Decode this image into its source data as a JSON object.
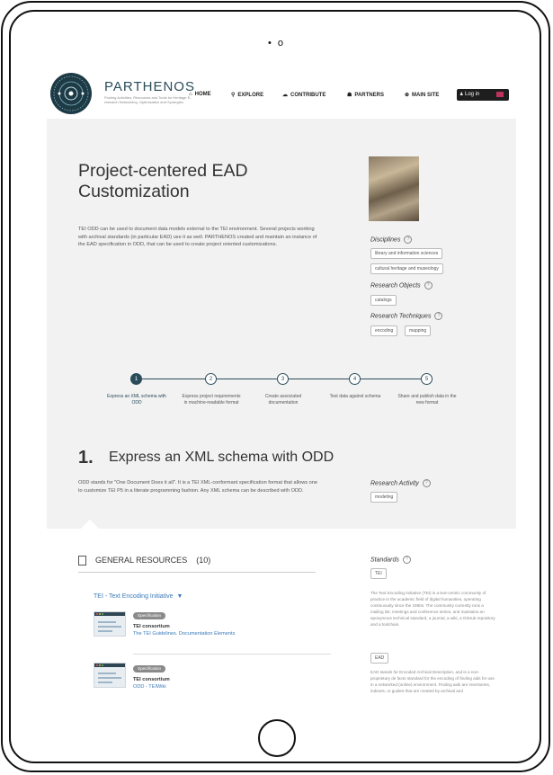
{
  "device": {
    "camera_dots": "• o"
  },
  "header": {
    "brand": "PARTHENOS",
    "tagline": "Pooling Activities, Resources and Tools for Heritage E-research Networking, Optimization and Synergies",
    "nav": [
      {
        "label": "HOME",
        "icon": "home-icon",
        "glyph": "⌂"
      },
      {
        "label": "EXPLORE",
        "icon": "search-icon",
        "glyph": "⚲"
      },
      {
        "label": "CONTRIBUTE",
        "icon": "cloud-upload-icon",
        "glyph": "☁"
      },
      {
        "label": "PARTNERS",
        "icon": "people-icon",
        "glyph": "☗"
      },
      {
        "label": "MAIN SITE",
        "icon": "globe-icon",
        "glyph": "⊕"
      }
    ],
    "login_label": "Log in",
    "login_glyph": "♟"
  },
  "page": {
    "title": "Project-centered EAD Customization",
    "intro": "TEI ODD can be used to document data models external to the TEI environment. Several projects working with archival standards (in particular EAD) use it as well. PARTHENOS created and maintain an instance of the EAD specification in ODD, that can be used to create project oriented customizations."
  },
  "sidebar": {
    "help_glyph": "?",
    "disciplines_label": "Disciplines",
    "disciplines": [
      "library and information sciences",
      "cultural heritage and museology"
    ],
    "research_objects_label": "Research Objects",
    "research_objects": [
      "catalogs"
    ],
    "research_techniques_label": "Research Techniques",
    "research_techniques": [
      "encoding",
      "mapping"
    ]
  },
  "steps": [
    {
      "num": "1",
      "label": "Express an XML schema with ODD",
      "active": true
    },
    {
      "num": "2",
      "label": "Express project requirements in machine-readable format",
      "active": false
    },
    {
      "num": "3",
      "label": "Create associated documentation",
      "active": false
    },
    {
      "num": "4",
      "label": "Test data against schema",
      "active": false
    },
    {
      "num": "5",
      "label": "Share and publish data in the new format",
      "active": false
    }
  ],
  "section": {
    "number": "1.",
    "title": "Express an XML schema with ODD",
    "text": "ODD stands for \"One Document Does it all\". It is a TEI XML-conformant specification format that allows one to customize TEI P5 in a literate programming fashion. Any XML schema can be described with ODD.",
    "activity_label": "Research Activity",
    "activity_tags": [
      "modeling"
    ]
  },
  "resources": {
    "heading": "GENERAL RESOURCES",
    "count": "(10)",
    "group": "TEI - Text Encoding Initiative",
    "group_toggle": "▼",
    "items": [
      {
        "badge": "Specification",
        "org": "TEI consortium",
        "title": "The TEI Guidelines. Documentation Elements"
      },
      {
        "badge": "Specification",
        "org": "TEI consortium",
        "title": "ODD - TEIWiki"
      }
    ]
  },
  "standards": {
    "label": "Standards",
    "items": [
      {
        "tag": "TEI",
        "text": "The Text Encoding Initiative (TEI) is a text-centric community of practice in the academic field of digital humanities, operating continuously since the 1980s. The community currently runs a mailing list, meetings and conference series, and maintains an eponymous technical standard, a journal, a wiki, a GitHub repository and a toolchain."
      },
      {
        "tag": "EAD",
        "text": "EAD stands for Encoded Archival Description, and is a non-proprietary de facto standard for the encoding of finding aids for use in a networked (online) environment. Finding aids are inventories, indexes, or guides that are created by archival and"
      }
    ]
  }
}
